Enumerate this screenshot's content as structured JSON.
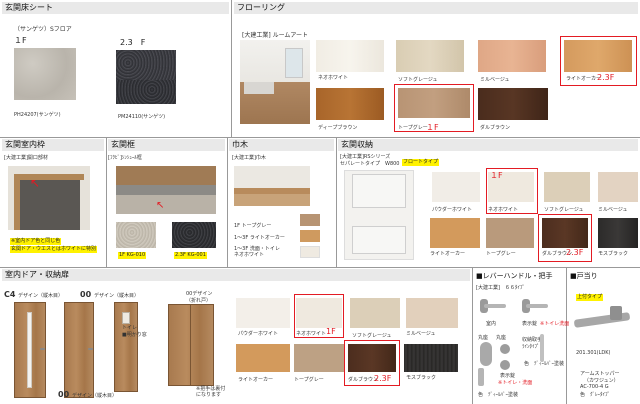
{
  "sections": {
    "entrance_sheet": "玄関床シート",
    "flooring": "フローリング",
    "entrance_frame": "玄関室内枠",
    "entrance_trim": "玄関框",
    "baseboard": "巾木",
    "entrance_storage": "玄関収納",
    "door": "室内ドア・収納扉",
    "lever": "■レバーハンドル・把手",
    "stopper": "■戸当り"
  },
  "entrance_sheet": {
    "maker": "（サンゲツ）Sフロア",
    "floor1": "１F",
    "floor23": "2.3　F",
    "code1": "PH24207(サンゲツ)",
    "code2": "PM24110(サンゲツ)"
  },
  "flooring": {
    "maker": "[大建工業] ルームアート",
    "swatches": [
      "ネオホワイト",
      "ソフトグレージュ",
      "ミルベージュ",
      "ライトオーカー",
      "ディープブラウン",
      "トープグレー",
      "ダルブラウン"
    ],
    "floor_23": "2.3F",
    "floor_1": "１F"
  },
  "entrance_frame": {
    "maker": "[大建工業]開口部材",
    "note1": "※室内ドア色と同じ色",
    "note2": "玄関ドア・ウエスとはホワイトに特別"
  },
  "entrance_trim": {
    "maker": "[ﾌｸﾋﾞ]ｼﾝｼｭｰﾙ框",
    "code1": "1F KG-010",
    "code2": "2.3F KG-001"
  },
  "baseboard": {
    "maker": "[大建工業]巾木",
    "line1": "1F トープグレー",
    "line2": "1〜3F ライトオーカー",
    "line3": "1〜3F 洗面・トイレ ネオホワイト"
  },
  "entrance_storage": {
    "maker": "[大建工業]RSシリーズ",
    "type": "セパレートタイプ　W800",
    "type_tag": "フロートタイプ",
    "floor1": "１F",
    "floor23": "2.3F",
    "swatches": [
      "パウダーホワイト",
      "ネオホワイト",
      "ソフトグレージュ",
      "ミルベージュ",
      "ライトオーカー",
      "トープグレー",
      "ダルブラウン",
      "モスブラック"
    ]
  },
  "door": {
    "c4": "C4",
    "c4_design": "デザイン（縦木目）",
    "d00a": "00",
    "d00a_design": "デザイン（縦木目）",
    "d00b": "00",
    "d00b_design": "デザイン（縦木目）",
    "d00c": "00デザイン",
    "d00c_sub": "（折れ戸）",
    "toilet": "トイレ",
    "toilet_sub": "■明かり窓",
    "note": "※把手は裏付になります",
    "swatches": [
      "パウダーホワイト",
      "ネオホワイト",
      "ソフトグレージュ",
      "ミルベージュ",
      "ライトオーカー",
      "トープグレー",
      "ダルブラウン",
      "モスブラック"
    ],
    "floor1": "1F",
    "floor23": "2.3F"
  },
  "lever": {
    "maker": "[大建工業]　６６ﾀｲﾌﾟ",
    "l1": "室内",
    "l2": "表示錠",
    "l2_note": "※トイレ洗面",
    "l3": "丸座",
    "l4": "丸座",
    "l5": "収納取手",
    "l5_sub": "ﾗｲﾝﾀｲﾌﾟ",
    "l6": "表示錠",
    "l6_note": "※トイレ・洗面",
    "color": "色　ﾃﾞｨｰﾙﾊﾞｰ塗装",
    "color2": "色　ﾃﾞｨｰﾙﾊﾞｰ塗装"
  },
  "stopper": {
    "tag": "上付タイプ",
    "code": "201.301(LDK)",
    "name": "アームストッパー",
    "name_sub": "（カワジュン）",
    "part": "AC-700-4 G",
    "color": "色　ｸﾞﾚｰﾀｲﾌﾟ"
  },
  "colors": {
    "accent_red": "#e31b23",
    "header_bg": "#e9e9e9",
    "tag_yellow": "#fff200"
  }
}
